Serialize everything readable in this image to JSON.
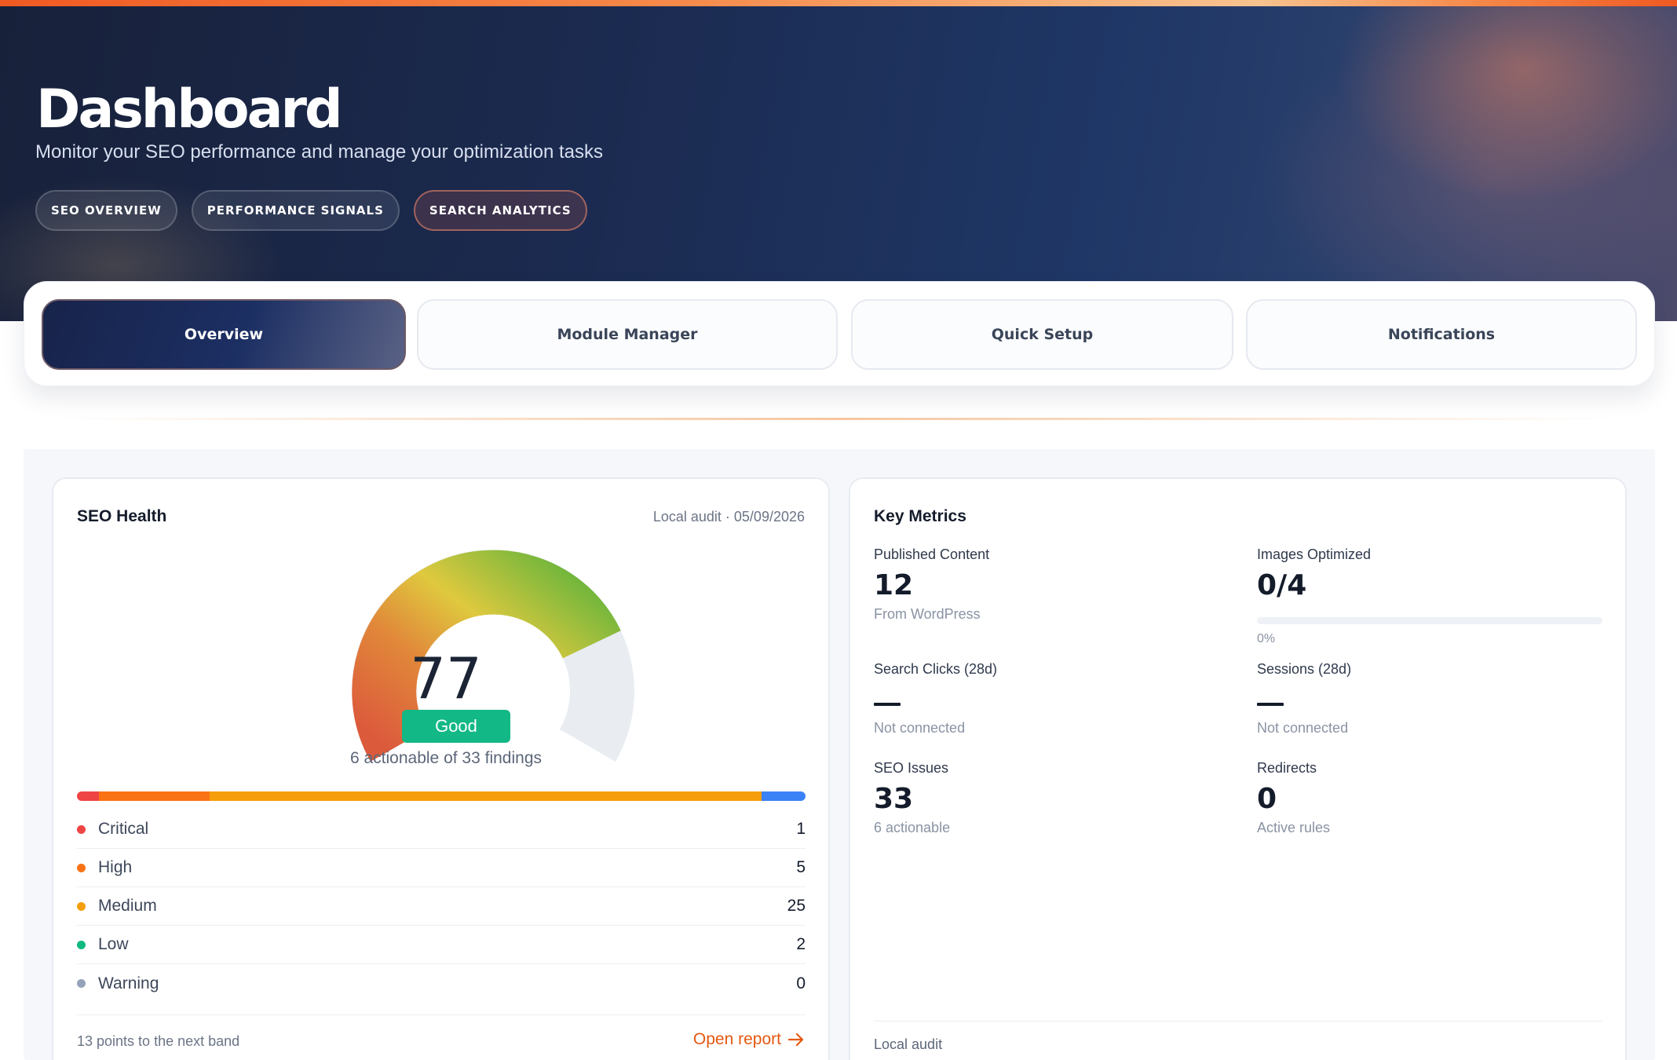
{
  "hero": {
    "title": "Dashboard",
    "subtitle": "Monitor your SEO performance and manage your optimization tasks",
    "chips": [
      "SEO OVERVIEW",
      "PERFORMANCE SIGNALS",
      "SEARCH ANALYTICS"
    ],
    "active_chip": "SEARCH ANALYTICS"
  },
  "tabs": [
    {
      "label": "Overview",
      "active": true
    },
    {
      "label": "Module Manager",
      "active": false
    },
    {
      "label": "Quick Setup",
      "active": false
    },
    {
      "label": "Notifications",
      "active": false
    }
  ],
  "seo_health": {
    "title": "SEO Health",
    "audit_meta": "Local audit · 05/09/2026",
    "score": "77",
    "score_value": 77,
    "score_max": 100,
    "band": "Good",
    "findings_text": "6 actionable of 33 findings",
    "severities": [
      {
        "label": "Critical",
        "count": "1",
        "color": "#ef4444"
      },
      {
        "label": "High",
        "count": "5",
        "color": "#f97316"
      },
      {
        "label": "Medium",
        "count": "25",
        "color": "#f59e0b"
      },
      {
        "label": "Low",
        "count": "2",
        "color": "#10b981"
      },
      {
        "label": "Warning",
        "count": "0",
        "color": "#94a3b8"
      }
    ],
    "next_band_text": "13 points to the next band",
    "open_report": "Open report"
  },
  "key_metrics": {
    "title": "Key Metrics",
    "published_content": {
      "label": "Published Content",
      "value": "12",
      "note": "From WordPress"
    },
    "images_optimized": {
      "label": "Images Optimized",
      "value": "0/4",
      "progress": 0,
      "note": "0%"
    },
    "search_clicks": {
      "label": "Search Clicks (28d)",
      "note": "Not connected"
    },
    "sessions": {
      "label": "Sessions (28d)",
      "note": "Not connected"
    },
    "seo_issues": {
      "label": "SEO Issues",
      "value": "33",
      "note": "6 actionable"
    },
    "redirects": {
      "label": "Redirects",
      "value": "0",
      "note": "Active rules"
    },
    "footer": "Local audit"
  },
  "colors": {
    "accent": "#e5580f",
    "good": "#12b886",
    "hero_dark": "#18213a"
  }
}
